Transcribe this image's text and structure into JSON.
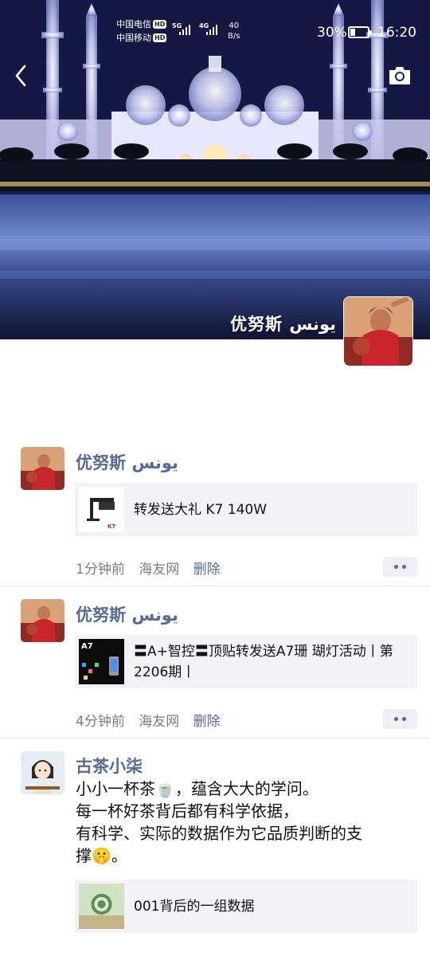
{
  "status_bar": {
    "carrier1": "中国电信",
    "carrier2": "中国移动",
    "hd": "HD",
    "net1": "5G",
    "net2": "4G",
    "speed_value": "40",
    "speed_unit": "B/s",
    "battery": "30%",
    "battery_level": 0.3,
    "time": "16:20"
  },
  "cover": {
    "username": "优努斯 يونس",
    "back_icon": "back-chevron-icon",
    "camera_icon": "camera-icon"
  },
  "posts": [
    {
      "author": "优努斯 يونس",
      "link_title": "转发送大礼 K7 140W",
      "time": "1分钟前",
      "source": "海友网",
      "delete": "删除"
    },
    {
      "author": "优努斯 يونس",
      "link_title": "〓A+智控〓顶贴转发送A7珊 瑚灯活动丨第2206期丨",
      "thumb_label": "A7",
      "time": "4分钟前",
      "source": "海友网",
      "delete": "删除"
    },
    {
      "author": "古茶小柒",
      "text_line1": "小小一杯茶🍵，蕴含大大的学问。",
      "text_line2": "每一杯好茶背后都有科学依据，",
      "text_line3": "有科学、实际的数据作为它品质判断的支",
      "text_line4": "撑🤫。",
      "link_title": "001背后的一组数据"
    }
  ],
  "colors": {
    "name_blue": "#576b95",
    "meta_gray": "#7d7d7d",
    "card_bg": "#f3f3f5"
  }
}
